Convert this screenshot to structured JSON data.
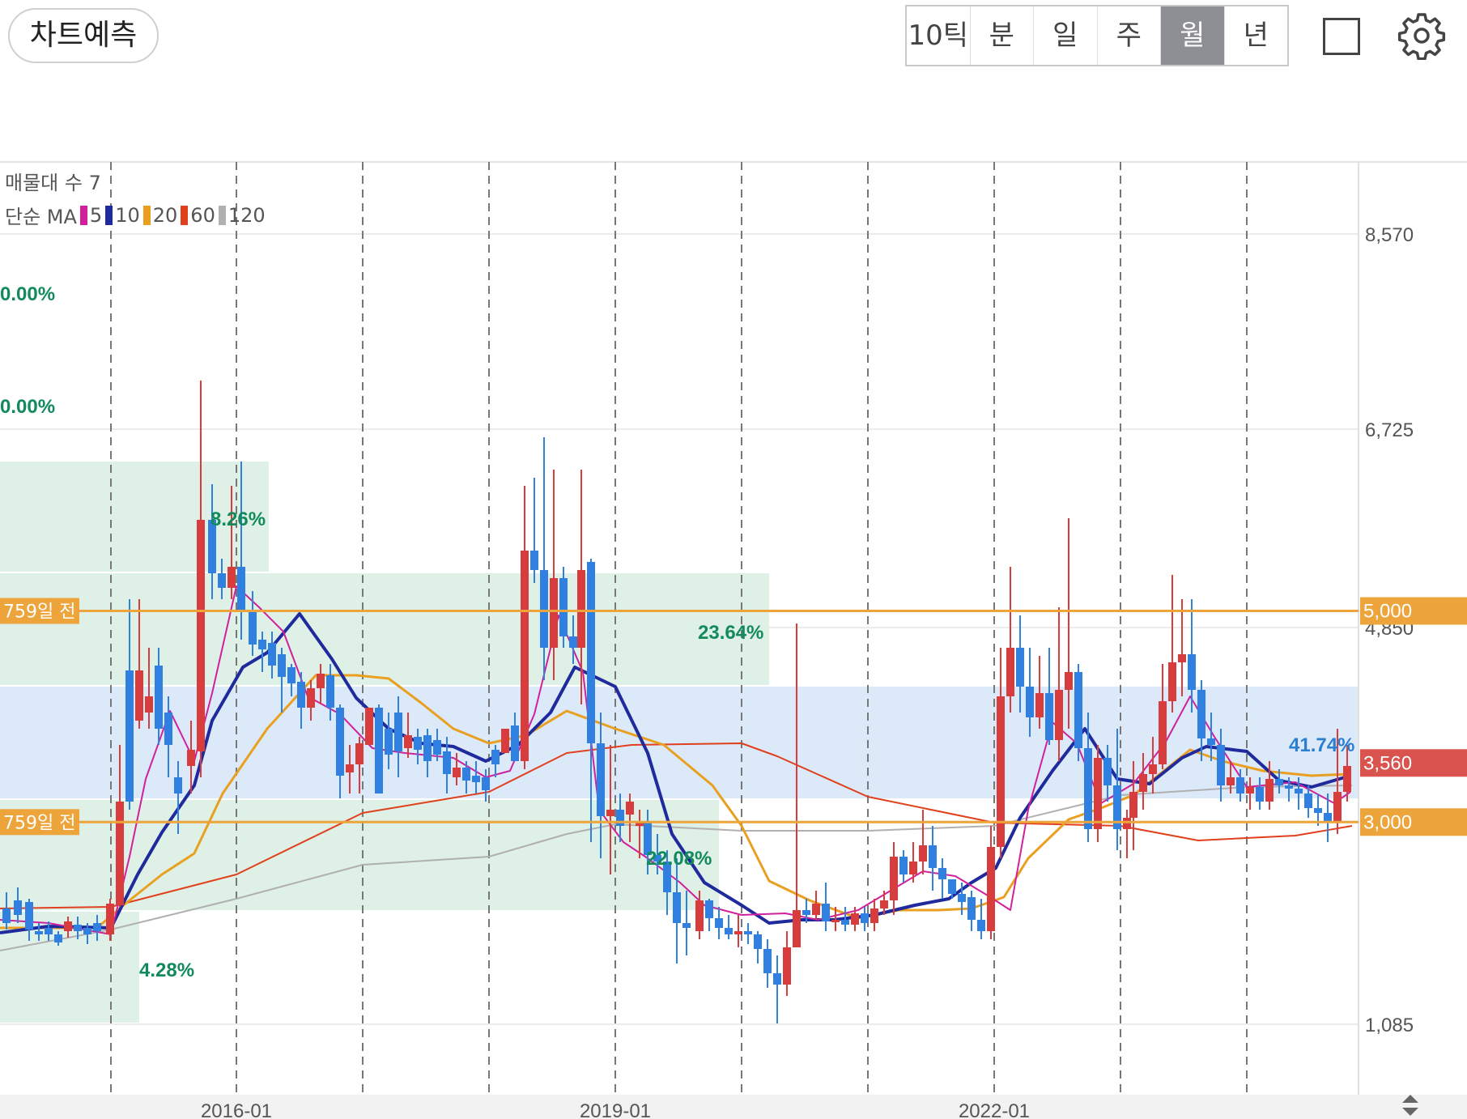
{
  "toolbar": {
    "predict_label": "차트예측",
    "periods": [
      "10틱",
      "분",
      "일",
      "주",
      "월",
      "년"
    ],
    "active_period": "월"
  },
  "legend": {
    "volume_profile": "매물대 수 7",
    "ma_prefix": "단순 MA",
    "ma": [
      {
        "label": "5",
        "color": "#d0219c"
      },
      {
        "label": "10",
        "color": "#1f2a9c"
      },
      {
        "label": "20",
        "color": "#e9a020"
      },
      {
        "label": "60",
        "color": "#e0401c"
      },
      {
        "label": "120",
        "color": "#b0b0b0"
      }
    ]
  },
  "colors": {
    "up": "#d93c3c",
    "down": "#2f80e0",
    "level_line": "#eda43a",
    "current_price": "#d9534f",
    "zone_green": "#dff0e7",
    "zone_blue": "#dbe9f9",
    "pct_green": "#128a5c",
    "pct_blue": "#2a7fd0"
  },
  "y_axis": {
    "ticks": [
      "8,570",
      "6,725",
      "4,850",
      "1,085"
    ]
  },
  "x_axis": {
    "ticks": [
      "2016-01",
      "2019-01",
      "2022-01"
    ]
  },
  "levels": [
    {
      "label": "759일 전",
      "price": 5000,
      "price_label": "5,000"
    },
    {
      "label": "759일 전",
      "price": 3000,
      "price_label": "3,000"
    }
  ],
  "current_price": {
    "value": 3560,
    "label": "3,560"
  },
  "percent_labels": {
    "top1": "0.00%",
    "top2": "0.00%",
    "zone1": "8.26%",
    "zone2": "23.64%",
    "zone3": "22.08%",
    "zone4": "4.28%",
    "zone_blue": "41.74%"
  }
}
